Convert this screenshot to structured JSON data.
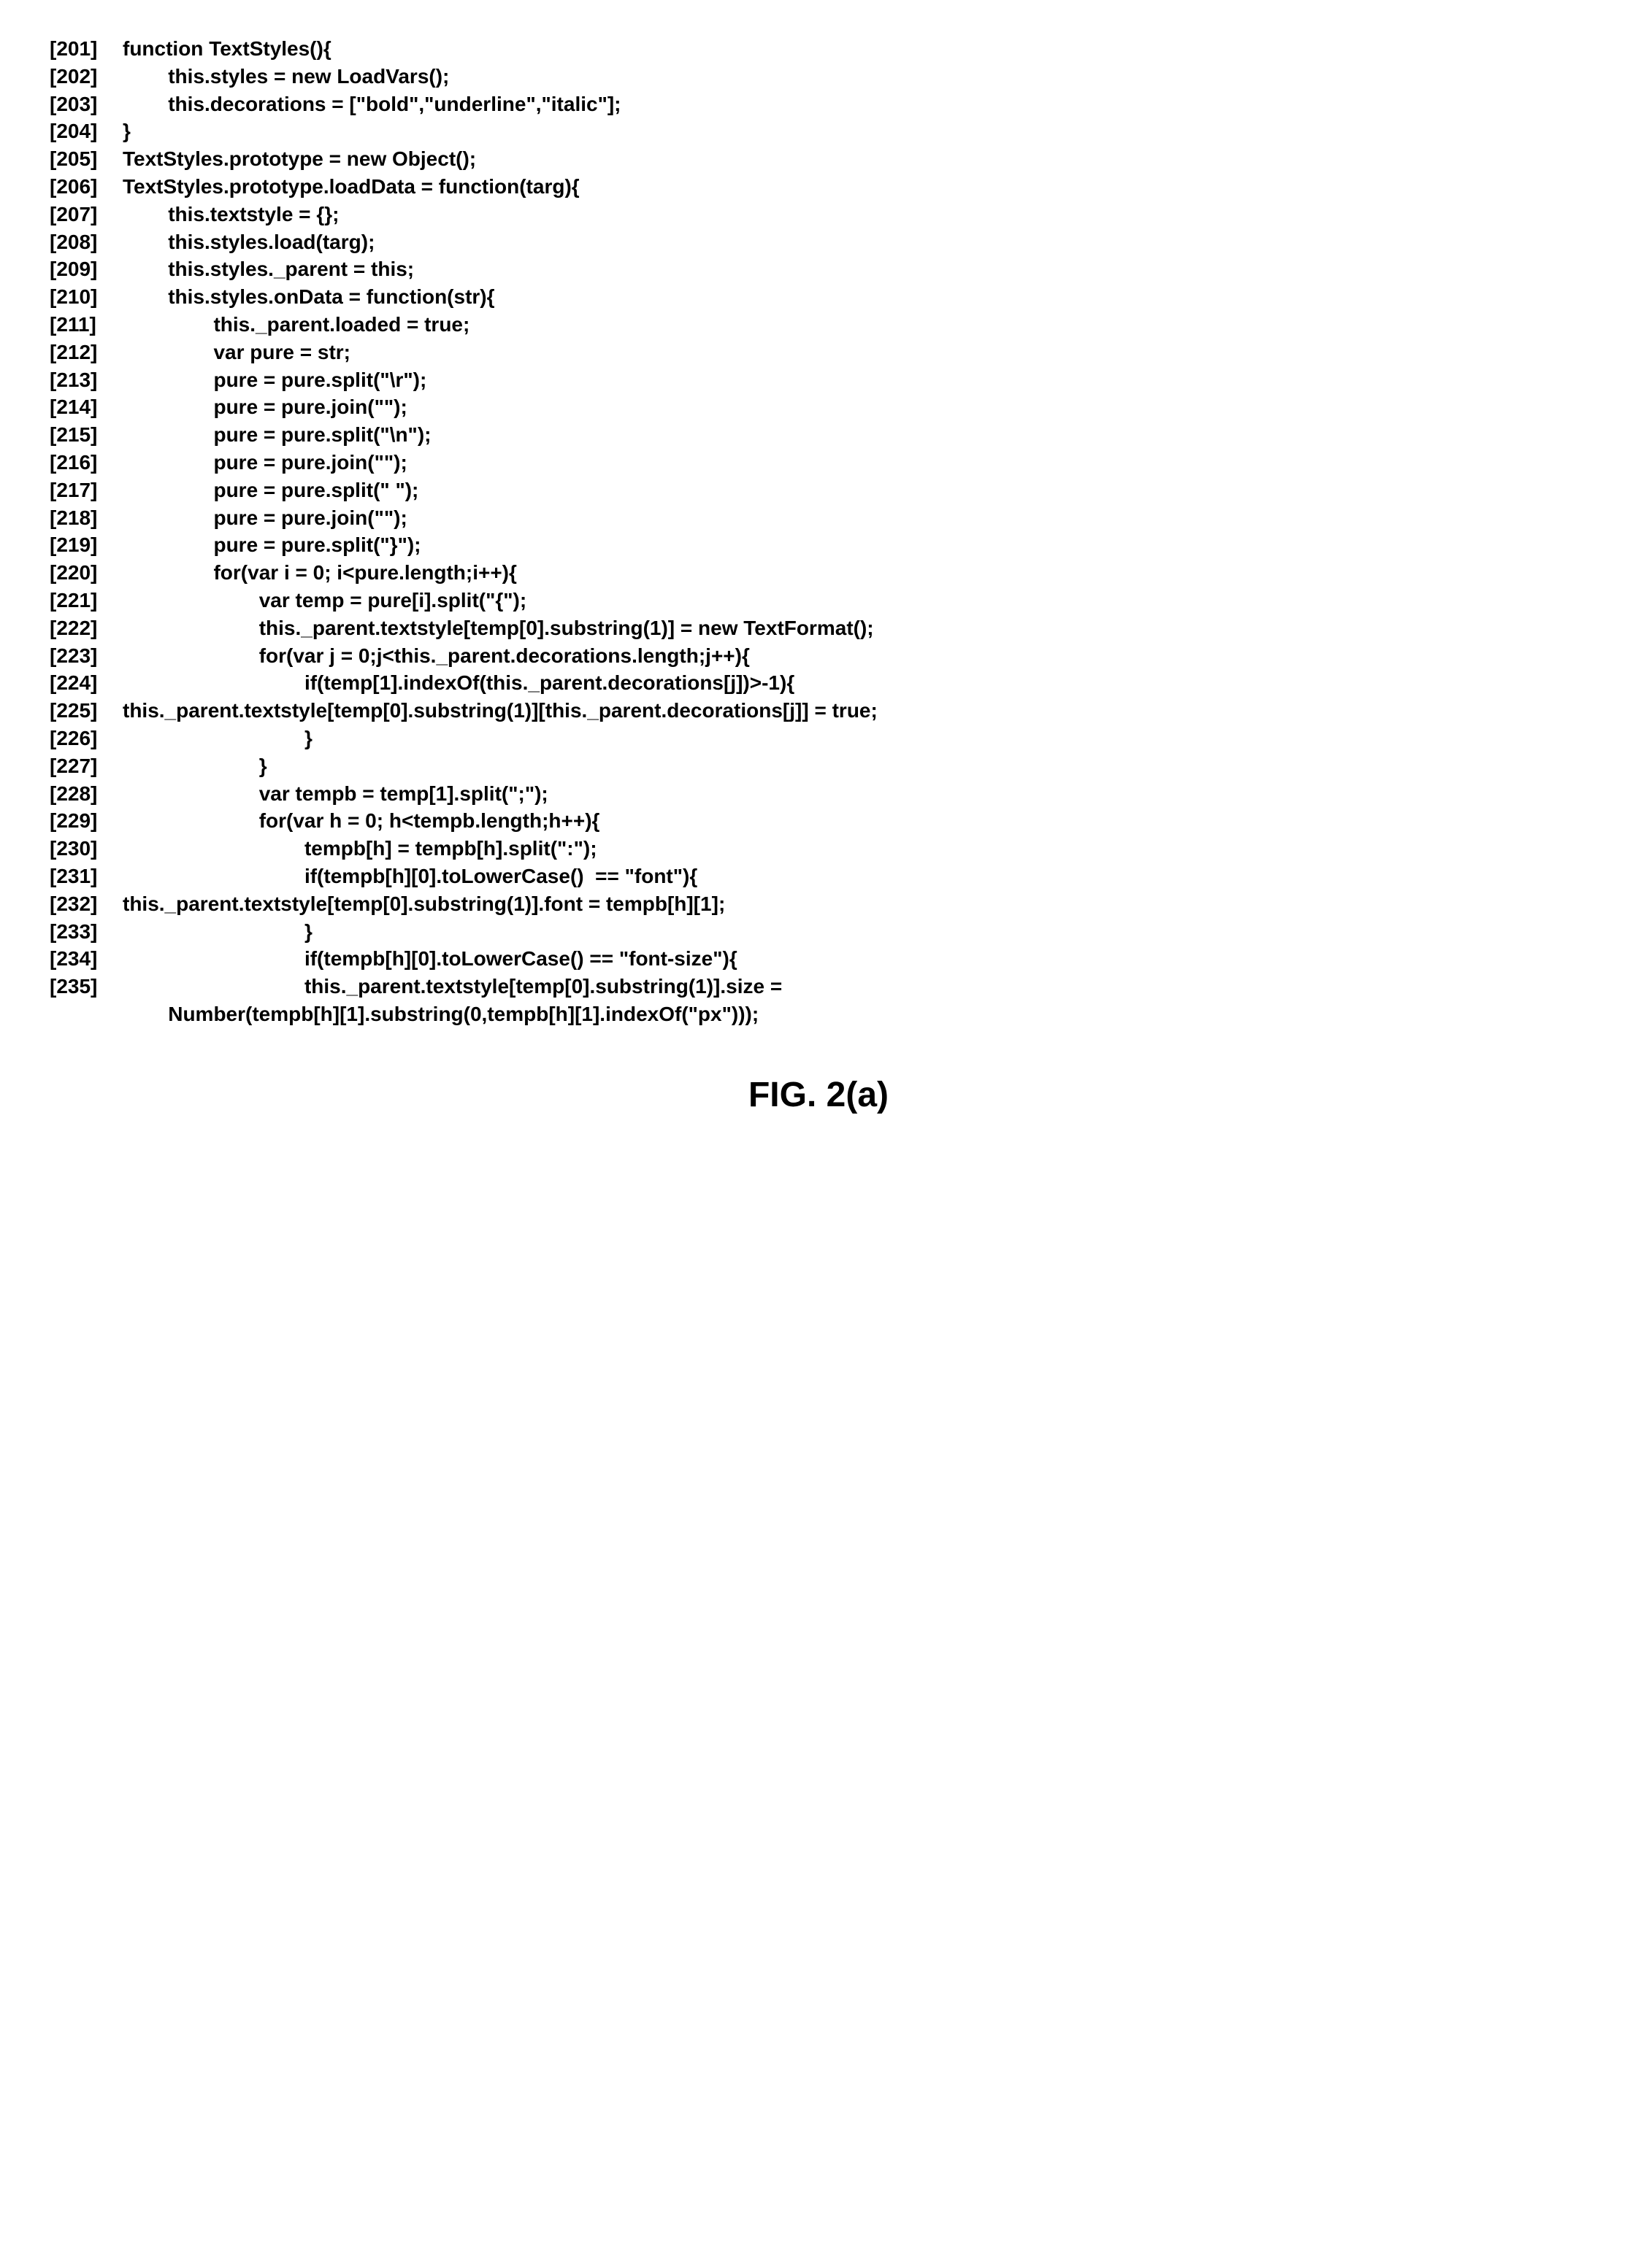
{
  "lines": [
    {
      "num": "[201]",
      "text": "function TextStyles(){"
    },
    {
      "num": "[202]",
      "text": "        this.styles = new LoadVars();"
    },
    {
      "num": "[203]",
      "text": "        this.decorations = [\"bold\",\"underline\",\"italic\"];"
    },
    {
      "num": "[204]",
      "text": "}"
    },
    {
      "num": "[205]",
      "text": "TextStyles.prototype = new Object();"
    },
    {
      "num": "[206]",
      "text": "TextStyles.prototype.loadData = function(targ){"
    },
    {
      "num": "[207]",
      "text": "        this.textstyle = {};"
    },
    {
      "num": "[208]",
      "text": "        this.styles.load(targ);"
    },
    {
      "num": "[209]",
      "text": "        this.styles._parent = this;"
    },
    {
      "num": "[210]",
      "text": "        this.styles.onData = function(str){"
    },
    {
      "num": "[211]",
      "text": "                this._parent.loaded = true;"
    },
    {
      "num": "[212]",
      "text": "                var pure = str;"
    },
    {
      "num": "[213]",
      "text": "                pure = pure.split(\"\\r\");"
    },
    {
      "num": "[214]",
      "text": "                pure = pure.join(\"\");"
    },
    {
      "num": "[215]",
      "text": "                pure = pure.split(\"\\n\");"
    },
    {
      "num": "[216]",
      "text": "                pure = pure.join(\"\");"
    },
    {
      "num": "[217]",
      "text": "                pure = pure.split(\" \");"
    },
    {
      "num": "[218]",
      "text": "                pure = pure.join(\"\");"
    },
    {
      "num": "[219]",
      "text": "                pure = pure.split(\"}\");"
    },
    {
      "num": "[220]",
      "text": "                for(var i = 0; i<pure.length;i++){"
    },
    {
      "num": "[221]",
      "text": "                        var temp = pure[i].split(\"{\");"
    },
    {
      "num": "[222]",
      "text": "                        this._parent.textstyle[temp[0].substring(1)] = new TextFormat();"
    },
    {
      "num": "[223]",
      "text": "                        for(var j = 0;j<this._parent.decorations.length;j++){"
    },
    {
      "num": "[224]",
      "text": "                                if(temp[1].indexOf(this._parent.decorations[j])>-1){"
    },
    {
      "num": "[225]",
      "text": "this._parent.textstyle[temp[0].substring(1)][this._parent.decorations[j]] = true;"
    },
    {
      "num": "[226]",
      "text": "                                }"
    },
    {
      "num": "[227]",
      "text": "                        }"
    },
    {
      "num": "[228]",
      "text": "                        var tempb = temp[1].split(\";\");"
    },
    {
      "num": "[229]",
      "text": "                        for(var h = 0; h<tempb.length;h++){"
    },
    {
      "num": "[230]",
      "text": "                                tempb[h] = tempb[h].split(\":\");"
    },
    {
      "num": "[231]",
      "text": "                                if(tempb[h][0].toLowerCase()  == \"font\"){"
    },
    {
      "num": "[232]",
      "text": "this._parent.textstyle[temp[0].substring(1)].font = tempb[h][1];"
    },
    {
      "num": "[233]",
      "text": "                                }"
    },
    {
      "num": "[234]",
      "text": "                                if(tempb[h][0].toLowerCase() == \"font-size\"){"
    },
    {
      "num": "[235]",
      "text": "                                this._parent.textstyle[temp[0].substring(1)].size ="
    },
    {
      "num": "",
      "text": "        Number(tempb[h][1].substring(0,tempb[h][1].indexOf(\"px\")));"
    }
  ],
  "figure_label": "FIG. 2(a)"
}
